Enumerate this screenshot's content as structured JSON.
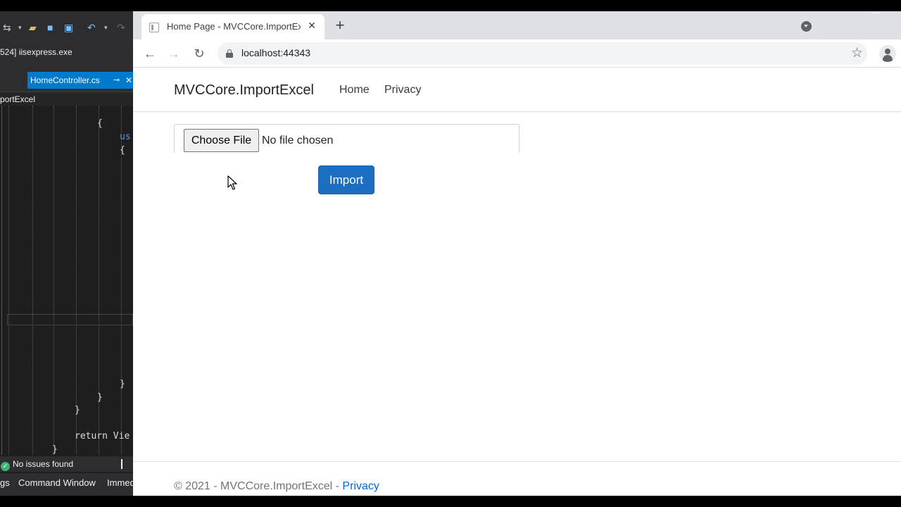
{
  "vs": {
    "process": "524] iisexpress.exe",
    "active_tab": "HomeController.cs",
    "tab_pin_glyph": "⊸",
    "tab_close_glyph": "✕",
    "breadcrumb": "portExcel",
    "code_lines": [
      "{",
      "us",
      "{",
      "}",
      "}",
      "}",
      "return Vie",
      "}"
    ],
    "status": "No issues found",
    "bottom_tabs": [
      "gs",
      "Command Window",
      "Immed"
    ]
  },
  "browser": {
    "tab_title": "Home Page - MVCCore.ImportExcel",
    "tab_close_glyph": "✕",
    "new_tab_glyph": "+",
    "url": "localhost:44343",
    "back_glyph": "←",
    "forward_glyph": "→",
    "reload_glyph": "↻",
    "star_glyph": "☆"
  },
  "page": {
    "brand": "MVCCore.ImportExcel",
    "nav": [
      {
        "label": "Home"
      },
      {
        "label": "Privacy"
      }
    ],
    "file_input": {
      "button_label": "Choose File",
      "status": "No file chosen"
    },
    "import_button": "Import",
    "footer": {
      "text": "© 2021 - MVCCore.ImportExcel - ",
      "link": "Privacy"
    }
  },
  "colors": {
    "vs_accent": "#007acc",
    "primary_button": "#1b6ec2",
    "link": "#0366d6"
  }
}
